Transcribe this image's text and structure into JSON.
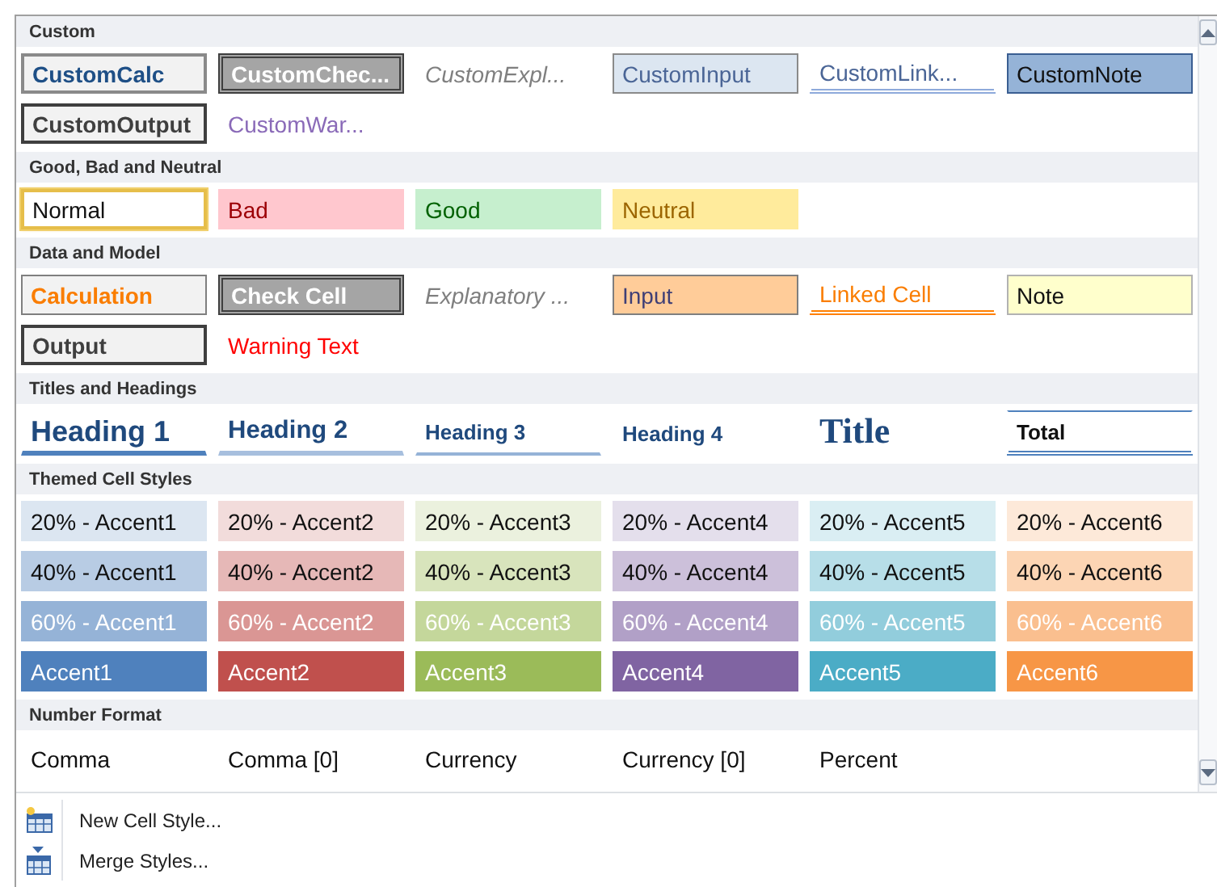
{
  "sections": [
    {
      "title": "Custom",
      "cells": [
        {
          "label": "CustomCalc",
          "kind": "custom-calc",
          "selected": false
        },
        {
          "label": "CustomChec...",
          "kind": "check",
          "selected": false
        },
        {
          "label": "CustomExpl...",
          "kind": "explanatory",
          "selected": false
        },
        {
          "label": "CustomInput",
          "kind": "custom-input",
          "selected": false
        },
        {
          "label": "CustomLink...",
          "kind": "custom-linked",
          "selected": false
        },
        {
          "label": "CustomNote",
          "kind": "custom-note",
          "selected": false
        },
        {
          "label": "CustomOutput",
          "kind": "output",
          "selected": false
        },
        {
          "label": "CustomWar...",
          "kind": "custom-warning",
          "selected": false
        }
      ]
    },
    {
      "title": "Good, Bad and Neutral",
      "cells": [
        {
          "label": "Normal",
          "kind": "normal",
          "selected": true
        },
        {
          "label": "Bad",
          "kind": "bad",
          "selected": false
        },
        {
          "label": "Good",
          "kind": "good",
          "selected": false
        },
        {
          "label": "Neutral",
          "kind": "neutral",
          "selected": false
        }
      ]
    },
    {
      "title": "Data and Model",
      "cells": [
        {
          "label": "Calculation",
          "kind": "calculation",
          "selected": false
        },
        {
          "label": "Check Cell",
          "kind": "check",
          "selected": false
        },
        {
          "label": "Explanatory ...",
          "kind": "explanatory",
          "selected": false
        },
        {
          "label": "Input",
          "kind": "input",
          "selected": false
        },
        {
          "label": "Linked Cell",
          "kind": "linked",
          "selected": false
        },
        {
          "label": "Note",
          "kind": "note",
          "selected": false
        },
        {
          "label": "Output",
          "kind": "output",
          "selected": false
        },
        {
          "label": "Warning Text",
          "kind": "warning",
          "selected": false
        }
      ]
    },
    {
      "title": "Titles and Headings",
      "cells": [
        {
          "label": "Heading 1",
          "kind": "heading1",
          "selected": false
        },
        {
          "label": "Heading 2",
          "kind": "heading2",
          "selected": false
        },
        {
          "label": "Heading 3",
          "kind": "heading3",
          "selected": false
        },
        {
          "label": "Heading 4",
          "kind": "heading4",
          "selected": false
        },
        {
          "label": "Title",
          "kind": "title",
          "selected": false
        },
        {
          "label": "Total",
          "kind": "total",
          "selected": false
        }
      ]
    },
    {
      "title": "Themed Cell Styles",
      "cells": [
        {
          "label": "20% - Accent1",
          "kind": "light",
          "color": "#dce6f1",
          "selected": false
        },
        {
          "label": "20% - Accent2",
          "kind": "light",
          "color": "#f2dcdb",
          "selected": false
        },
        {
          "label": "20% - Accent3",
          "kind": "light",
          "color": "#ebf1de",
          "selected": false
        },
        {
          "label": "20% - Accent4",
          "kind": "light",
          "color": "#e4dfec",
          "selected": false
        },
        {
          "label": "20% - Accent5",
          "kind": "light",
          "color": "#daeef3",
          "selected": false
        },
        {
          "label": "20% - Accent6",
          "kind": "light",
          "color": "#fde9d9",
          "selected": false
        },
        {
          "label": "40% - Accent1",
          "kind": "light",
          "color": "#b8cce4",
          "selected": false
        },
        {
          "label": "40% - Accent2",
          "kind": "light",
          "color": "#e6b8b7",
          "selected": false
        },
        {
          "label": "40% - Accent3",
          "kind": "light",
          "color": "#d8e4bc",
          "selected": false
        },
        {
          "label": "40% - Accent4",
          "kind": "light",
          "color": "#ccc0da",
          "selected": false
        },
        {
          "label": "40% - Accent5",
          "kind": "light",
          "color": "#b7dee8",
          "selected": false
        },
        {
          "label": "40% - Accent6",
          "kind": "light",
          "color": "#fcd5b4",
          "selected": false
        },
        {
          "label": "60% - Accent1",
          "kind": "medium",
          "color": "#95b3d7",
          "selected": false
        },
        {
          "label": "60% - Accent2",
          "kind": "medium",
          "color": "#da9694",
          "selected": false
        },
        {
          "label": "60% - Accent3",
          "kind": "medium",
          "color": "#c4d79b",
          "selected": false
        },
        {
          "label": "60% - Accent4",
          "kind": "medium",
          "color": "#b1a0c7",
          "selected": false
        },
        {
          "label": "60% - Accent5",
          "kind": "medium",
          "color": "#92cddc",
          "selected": false
        },
        {
          "label": "60% - Accent6",
          "kind": "medium",
          "color": "#fabf8f",
          "selected": false
        },
        {
          "label": "Accent1",
          "kind": "solid",
          "color": "#4f81bd",
          "selected": false
        },
        {
          "label": "Accent2",
          "kind": "solid",
          "color": "#c0504d",
          "selected": false
        },
        {
          "label": "Accent3",
          "kind": "solid",
          "color": "#9bbb59",
          "selected": false
        },
        {
          "label": "Accent4",
          "kind": "solid",
          "color": "#8064a2",
          "selected": false
        },
        {
          "label": "Accent5",
          "kind": "solid",
          "color": "#4bacc6",
          "selected": false
        },
        {
          "label": "Accent6",
          "kind": "solid",
          "color": "#f79646",
          "selected": false
        }
      ]
    },
    {
      "title": "Number Format",
      "cells": [
        {
          "label": "Comma",
          "kind": "plain",
          "selected": false
        },
        {
          "label": "Comma [0]",
          "kind": "plain",
          "selected": false
        },
        {
          "label": "Currency",
          "kind": "plain",
          "selected": false
        },
        {
          "label": "Currency [0]",
          "kind": "plain",
          "selected": false
        },
        {
          "label": "Percent",
          "kind": "plain",
          "selected": false
        }
      ]
    }
  ],
  "menu": [
    {
      "label": "New Cell Style...",
      "kind": "new"
    },
    {
      "label": "Merge Styles...",
      "kind": "merge"
    }
  ]
}
